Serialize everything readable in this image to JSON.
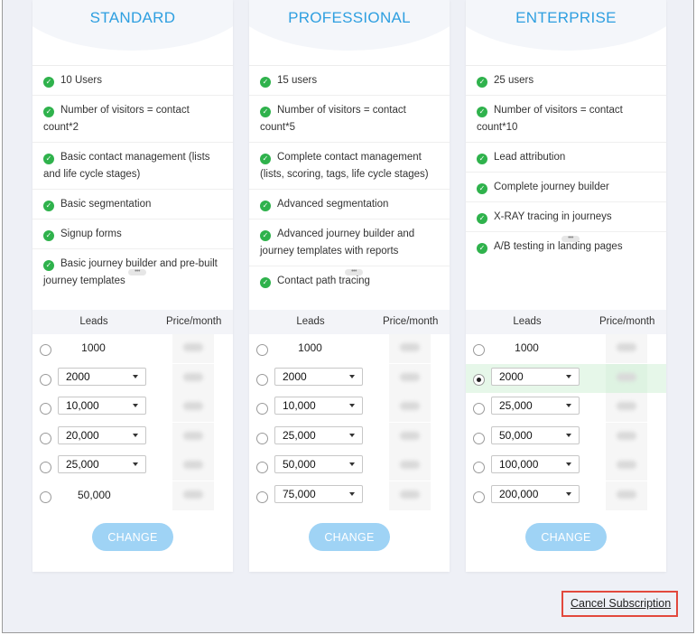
{
  "plans": [
    {
      "name": "STANDARD",
      "features": [
        "10 Users",
        "Number of visitors = contact count*2",
        "Basic contact management (lists and life cycle stages)",
        "Basic segmentation",
        "Signup forms",
        "Basic journey builder and pre-built journey templates"
      ],
      "more_icon": "ellipsis-icon",
      "table_headers": {
        "leads": "Leads",
        "price": "Price/month"
      },
      "rows": [
        {
          "value": "1000",
          "dropdown": false,
          "selected": false
        },
        {
          "value": "2000",
          "dropdown": true,
          "selected": false
        },
        {
          "value": "10,000",
          "dropdown": true,
          "selected": false
        },
        {
          "value": "20,000",
          "dropdown": true,
          "selected": false
        },
        {
          "value": "25,000",
          "dropdown": true,
          "selected": false
        },
        {
          "value": "50,000",
          "dropdown": false,
          "selected": false
        }
      ],
      "button": "CHANGE"
    },
    {
      "name": "PROFESSIONAL",
      "features": [
        "15 users",
        "Number of visitors = contact count*5",
        "Complete contact management (lists, scoring, tags, life cycle stages)",
        "Advanced segmentation",
        "Advanced journey builder and journey templates with reports",
        "Contact path tracing"
      ],
      "more_icon": "ellipsis-icon",
      "table_headers": {
        "leads": "Leads",
        "price": "Price/month"
      },
      "rows": [
        {
          "value": "1000",
          "dropdown": false,
          "selected": false
        },
        {
          "value": "2000",
          "dropdown": true,
          "selected": false
        },
        {
          "value": "10,000",
          "dropdown": true,
          "selected": false
        },
        {
          "value": "25,000",
          "dropdown": true,
          "selected": false
        },
        {
          "value": "50,000",
          "dropdown": true,
          "selected": false
        },
        {
          "value": "75,000",
          "dropdown": true,
          "selected": false
        }
      ],
      "button": "CHANGE"
    },
    {
      "name": "ENTERPRISE",
      "features": [
        "25 users",
        "Number of visitors = contact count*10",
        "Lead attribution",
        "Complete journey builder",
        "X-RAY tracing in journeys",
        "A/B testing in landing pages"
      ],
      "more_icon": "ellipsis-icon",
      "table_headers": {
        "leads": "Leads",
        "price": "Price/month"
      },
      "rows": [
        {
          "value": "1000",
          "dropdown": false,
          "selected": false
        },
        {
          "value": "2000",
          "dropdown": true,
          "selected": true
        },
        {
          "value": "25,000",
          "dropdown": true,
          "selected": false
        },
        {
          "value": "50,000",
          "dropdown": true,
          "selected": false
        },
        {
          "value": "100,000",
          "dropdown": true,
          "selected": false
        },
        {
          "value": "200,000",
          "dropdown": true,
          "selected": false
        }
      ],
      "button": "CHANGE"
    }
  ],
  "cancel_subscription": "Cancel Subscription",
  "colors": {
    "plan_title": "#2e9fe0",
    "check": "#2fb24c",
    "change_button": "#9fd3f5",
    "selected_row": "#e6f7e9",
    "cancel_highlight": "#e2483d",
    "background": "#eef0f6"
  }
}
